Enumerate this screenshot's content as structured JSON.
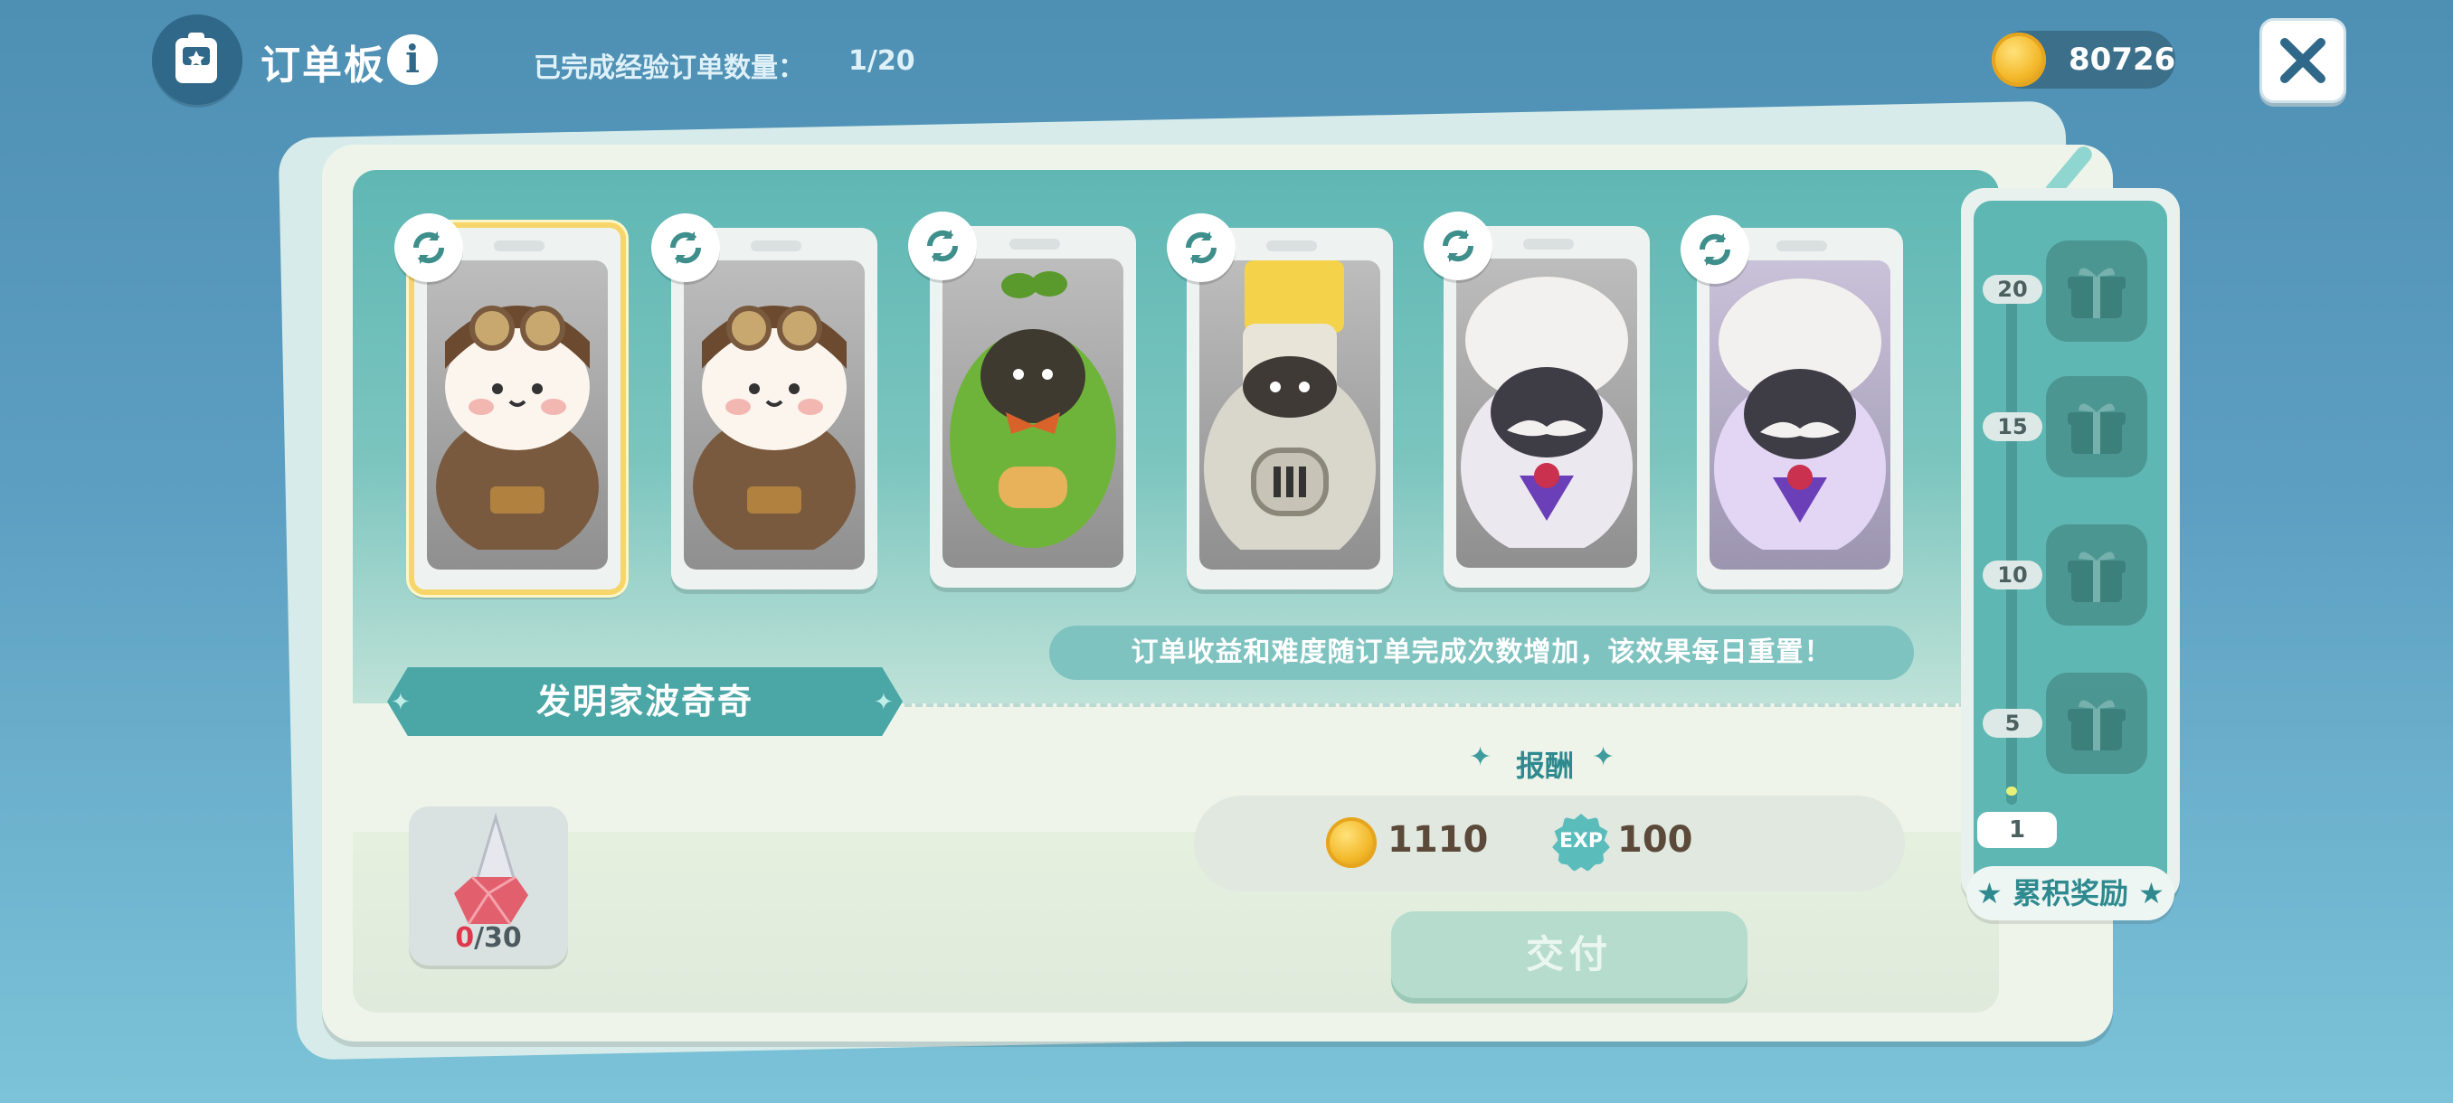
{
  "header": {
    "title": "订单板",
    "info_icon": "i",
    "completed_label": "已完成经验订单数量：",
    "completed_value": "1/20",
    "coins": "80726"
  },
  "orders": [
    {
      "character": "inventor-bunny-brown",
      "selected": true
    },
    {
      "character": "inventor-bunny-brown"
    },
    {
      "character": "leaf-sprout-green"
    },
    {
      "character": "paint-bucket-robot"
    },
    {
      "character": "royal-chef-white"
    },
    {
      "character": "royal-chef-purple",
      "rare": true
    }
  ],
  "notice": "订单收益和难度随订单完成次数增加，该效果每日重置！",
  "selected_name": "发明家波奇奇",
  "requirement": {
    "current": "0",
    "required": "/30",
    "item_icon": "red-crystal-cone-icon"
  },
  "reward": {
    "title": "报酬",
    "coins": "1110",
    "exp_icon_label": "EXP",
    "exp": "100"
  },
  "deliver_button": "交付",
  "accumulated": {
    "levels": [
      "20",
      "15",
      "10",
      "5"
    ],
    "current_level": "1",
    "label": "累积奖励",
    "progress": 0.05
  }
}
